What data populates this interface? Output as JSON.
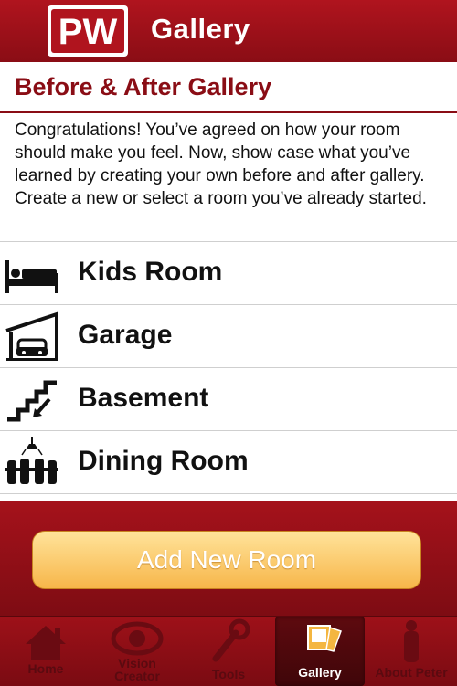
{
  "header": {
    "logo_text": "PW",
    "title": "Gallery"
  },
  "page": {
    "section_title": "Before & After Gallery",
    "intro": "Congratulations! You’ve agreed on how your room should make you feel. Now, show case what you’ve learned by creating your own before and after gallery. Create a new or select a room you’ve already started."
  },
  "rooms": [
    {
      "label": "Kids Room",
      "icon": "bed-icon"
    },
    {
      "label": "Garage",
      "icon": "garage-icon"
    },
    {
      "label": "Basement",
      "icon": "stairs-icon"
    },
    {
      "label": "Dining Room",
      "icon": "dining-icon"
    }
  ],
  "actions": {
    "add_room": "Add New Room"
  },
  "tabbar": {
    "home": "Home",
    "vision_line1": "Vision",
    "vision_line2": "Creator",
    "tools": "Tools",
    "gallery": "Gallery",
    "about": "About Peter",
    "active": "gallery"
  },
  "colors": {
    "brand_red": "#8a0d15",
    "button_orange": "#f7b64a"
  }
}
